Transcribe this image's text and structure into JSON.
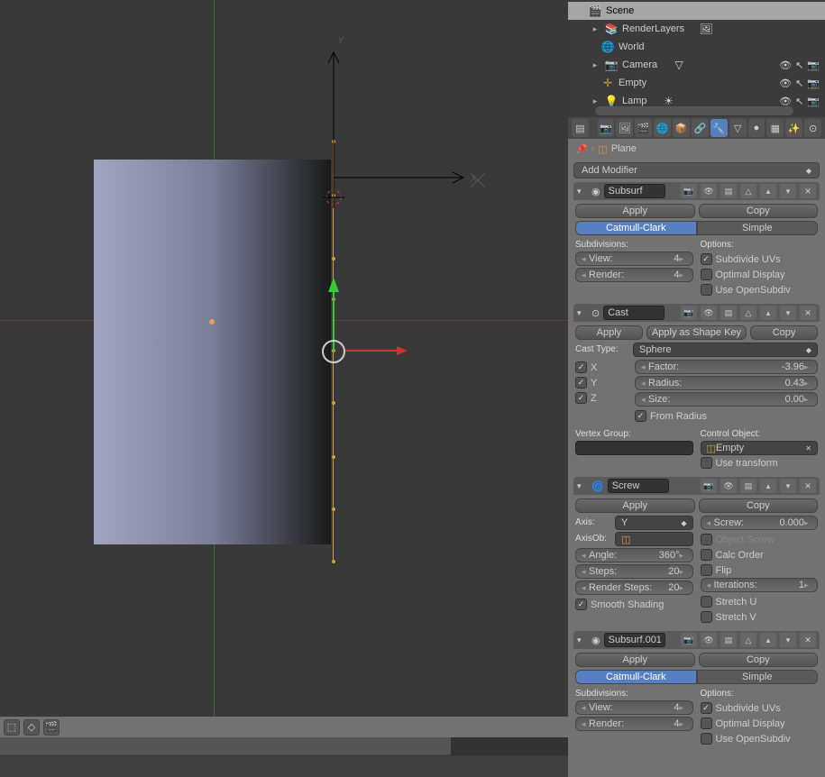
{
  "outliner": {
    "items": [
      {
        "label": "Scene",
        "icon": "scene",
        "indent": 0,
        "expanded": true,
        "selected": true
      },
      {
        "label": "RenderLayers",
        "icon": "layers",
        "indent": 1,
        "expanded": false,
        "extra_icon": "image"
      },
      {
        "label": "World",
        "icon": "world",
        "indent": 1
      },
      {
        "label": "Camera",
        "icon": "camera",
        "indent": 1,
        "expanded": false,
        "extra_icon": "camera-data",
        "vis": true
      },
      {
        "label": "Empty",
        "icon": "empty",
        "indent": 1,
        "vis": true
      },
      {
        "label": "Lamp",
        "icon": "lamp",
        "indent": 1,
        "expanded": false,
        "extra_icon": "lamp-data",
        "vis": true
      }
    ]
  },
  "breadcrumb": {
    "object": "Plane"
  },
  "add_modifier_label": "Add Modifier",
  "modifiers": {
    "subsurf1": {
      "name": "Subsurf",
      "apply": "Apply",
      "copy": "Copy",
      "tabs": {
        "catmull": "Catmull-Clark",
        "simple": "Simple"
      },
      "subdivisions_label": "Subdivisions:",
      "view": {
        "label": "View:",
        "value": "4"
      },
      "render": {
        "label": "Render:",
        "value": "4"
      },
      "options_label": "Options:",
      "subdivide_uvs": "Subdivide UVs",
      "optimal_display": "Optimal Display",
      "use_opensubdiv": "Use OpenSubdiv"
    },
    "cast": {
      "name": "Cast",
      "apply": "Apply",
      "apply_shape": "Apply as Shape Key",
      "copy": "Copy",
      "cast_type_label": "Cast Type:",
      "cast_type_value": "Sphere",
      "x": "X",
      "y": "Y",
      "z": "Z",
      "factor": {
        "label": "Factor:",
        "value": "-3.96"
      },
      "radius": {
        "label": "Radius:",
        "value": "0.43"
      },
      "size": {
        "label": "Size:",
        "value": "0.00"
      },
      "from_radius": "From Radius",
      "vertex_group_label": "Vertex Group:",
      "control_object_label": "Control Object:",
      "control_object_value": "Empty",
      "use_transform": "Use transform"
    },
    "screw": {
      "name": "Screw",
      "apply": "Apply",
      "copy": "Copy",
      "axis": {
        "label": "Axis:",
        "value": "Y"
      },
      "axis_ob": {
        "label": "AxisOb:"
      },
      "angle": {
        "label": "Angle:",
        "value": "360°"
      },
      "steps": {
        "label": "Steps:",
        "value": "20"
      },
      "render_steps": {
        "label": "Render Steps:",
        "value": "20"
      },
      "smooth_shading": "Smooth Shading",
      "screw": {
        "label": "Screw:",
        "value": "0.000"
      },
      "object_screw": "Object Screw",
      "calc_order": "Calc Order",
      "flip": "Flip",
      "iterations": {
        "label": "Iterations:",
        "value": "1"
      },
      "stretch_u": "Stretch U",
      "stretch_v": "Stretch V"
    },
    "subsurf2": {
      "name": "Subsurf.001",
      "apply": "Apply",
      "copy": "Copy",
      "tabs": {
        "catmull": "Catmull-Clark",
        "simple": "Simple"
      },
      "subdivisions_label": "Subdivisions:",
      "view": {
        "label": "View:",
        "value": "4"
      },
      "render": {
        "label": "Render:",
        "value": "4"
      },
      "options_label": "Options:",
      "subdivide_uvs": "Subdivide UVs",
      "optimal_display": "Optimal Display",
      "use_opensubdiv": "Use OpenSubdiv"
    }
  }
}
